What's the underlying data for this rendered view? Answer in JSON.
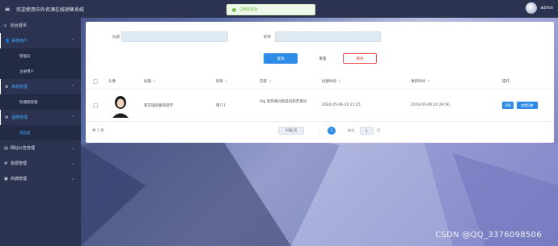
{
  "header": {
    "menu_icon": "hamburger-icon",
    "title": "欢迎使用中外名酒在线销售系统",
    "user": "admin"
  },
  "toast": {
    "icon": "check-circle-icon",
    "text": "已更新成功"
  },
  "sidebar": {
    "items": [
      {
        "label": "后台首页",
        "icon": "home-icon",
        "chevron": ""
      },
      {
        "label": "系统用户",
        "icon": "user-icon",
        "chevron": "⌃",
        "active": true
      },
      {
        "label": "管理员",
        "sub": true
      },
      {
        "label": "注册用户",
        "sub": true
      },
      {
        "label": "系统管理",
        "icon": "gear-icon",
        "chevron": "⌃",
        "active": true
      },
      {
        "label": "轮播图管理",
        "sub": true
      },
      {
        "label": "酒类管理",
        "icon": "gear-icon",
        "chevron": "⌃",
        "active": true
      },
      {
        "label": "酒品类",
        "sub": true,
        "current": true
      },
      {
        "label": "网站公告管理",
        "icon": "doc-icon",
        "chevron": "⌄"
      },
      {
        "label": "资源管理",
        "icon": "gear-icon",
        "chevron": "⌄"
      },
      {
        "label": "商城管理",
        "icon": "shop-icon",
        "chevron": "⌄"
      }
    ]
  },
  "search": {
    "field1_label": "标题",
    "field1_value": "",
    "field2_label": "昵称",
    "field2_value": ""
  },
  "buttons": {
    "search": "查询",
    "reset": "重置",
    "delete": "删除"
  },
  "table": {
    "headers": [
      "头像",
      "标题",
      "昵称",
      "内容",
      "创建时间",
      "更新时间",
      "操作"
    ],
    "rows": [
      {
        "title": "南京国际葡萄酒节",
        "nickname": "用户1",
        "content": "fdg 和苏果同和美同和苏果同",
        "created": "2024-05-06 20:21:25",
        "updated": "2024-05-06 20:29:56",
        "action_detail": "详情",
        "action_view": "查看回复"
      }
    ]
  },
  "pagination": {
    "total": "共 1 条",
    "page_size": "10条/页",
    "prev": "‹",
    "current": "1",
    "next": "›",
    "goto_label": "前往",
    "goto_value": "1",
    "page_suffix": "页"
  },
  "watermark": "CSDN @QQ_3376098506",
  "colors": {
    "primary": "#2e8ce8",
    "danger": "#e64d4d",
    "sidebar": "#2b3350",
    "success": "#67c23a"
  }
}
